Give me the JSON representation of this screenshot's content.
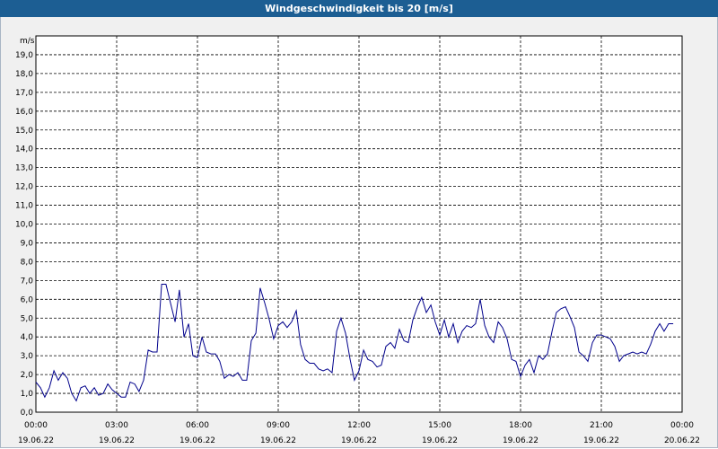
{
  "window": {
    "title": "Windgeschwindigkeit bis 20 [m/s]"
  },
  "colors": {
    "titlebar": "#1c5e93",
    "line": "#00008b",
    "grid": "#000000",
    "plot_bg": "#ffffff"
  },
  "chart_data": {
    "type": "line",
    "title": "Windgeschwindigkeit bis 20 [m/s]",
    "ylabel": "m/s",
    "xlabel": "",
    "ylim": [
      0,
      20
    ],
    "yticks": [
      "0,0",
      "1,0",
      "2,0",
      "3,0",
      "4,0",
      "5,0",
      "6,0",
      "7,0",
      "8,0",
      "9,0",
      "10,0",
      "11,0",
      "12,0",
      "13,0",
      "14,0",
      "15,0",
      "16,0",
      "17,0",
      "18,0",
      "19,0"
    ],
    "xticks": [
      {
        "time": "00:00",
        "date": "19.06.22"
      },
      {
        "time": "03:00",
        "date": "19.06.22"
      },
      {
        "time": "06:00",
        "date": "19.06.22"
      },
      {
        "time": "09:00",
        "date": "19.06.22"
      },
      {
        "time": "12:00",
        "date": "19.06.22"
      },
      {
        "time": "15:00",
        "date": "19.06.22"
      },
      {
        "time": "18:00",
        "date": "19.06.22"
      },
      {
        "time": "21:00",
        "date": "19.06.22"
      },
      {
        "time": "00:00",
        "date": "20.06.22"
      }
    ],
    "grid": true,
    "legend": "none",
    "series": [
      {
        "x_hours": [
          0,
          0.17,
          0.33,
          0.5,
          0.67,
          0.83,
          1,
          1.17,
          1.33,
          1.5,
          1.67,
          1.83,
          2,
          2.17,
          2.33,
          2.5,
          2.67,
          2.83,
          3,
          3.17,
          3.33,
          3.5,
          3.67,
          3.83,
          4,
          4.17,
          4.33,
          4.5,
          4.67,
          4.83,
          5,
          5.17,
          5.33,
          5.5,
          5.67,
          5.83,
          6,
          6.17,
          6.33,
          6.5,
          6.67,
          6.83,
          7,
          7.17,
          7.33,
          7.5,
          7.67,
          7.83,
          8,
          8.17,
          8.33,
          8.5,
          8.67,
          8.83,
          9,
          9.17,
          9.33,
          9.5,
          9.67,
          9.83,
          10,
          10.17,
          10.33,
          10.5,
          10.67,
          10.83,
          11,
          11.17,
          11.33,
          11.5,
          11.67,
          11.83,
          12,
          12.17,
          12.33,
          12.5,
          12.67,
          12.83,
          13,
          13.17,
          13.33,
          13.5,
          13.67,
          13.83,
          14,
          14.17,
          14.33,
          14.5,
          14.67,
          14.83,
          15,
          15.17,
          15.33,
          15.5,
          15.67,
          15.83,
          16,
          16.17,
          16.33,
          16.5,
          16.67,
          16.83,
          17,
          17.17,
          17.33,
          17.5,
          17.67,
          17.83,
          18,
          18.17,
          18.33,
          18.5,
          18.67,
          18.83,
          19,
          19.17,
          19.33,
          19.5,
          19.67,
          19.83,
          20,
          20.17,
          20.33,
          20.5,
          20.67,
          20.83,
          21,
          21.17,
          21.33,
          21.5,
          21.67,
          21.83,
          22,
          22.17,
          22.33,
          22.5,
          22.67,
          22.83,
          23,
          23.17,
          23.33,
          23.5,
          23.67,
          23.83
        ],
        "values": [
          1.6,
          1.3,
          0.8,
          1.3,
          2.2,
          1.7,
          2.1,
          1.8,
          1.0,
          0.6,
          1.3,
          1.4,
          1.0,
          1.3,
          0.9,
          1.0,
          1.5,
          1.2,
          1.0,
          0.8,
          0.8,
          1.6,
          1.5,
          1.1,
          1.7,
          3.3,
          3.2,
          3.2,
          6.8,
          6.8,
          5.8,
          4.8,
          6.5,
          4.0,
          4.7,
          3.0,
          2.9,
          4.0,
          3.2,
          3.1,
          3.1,
          2.7,
          1.8,
          2.0,
          1.9,
          2.1,
          1.7,
          1.7,
          3.8,
          4.2,
          6.6,
          5.8,
          4.9,
          3.9,
          4.6,
          4.8,
          4.5,
          4.8,
          5.4,
          3.6,
          2.8,
          2.6,
          2.6,
          2.3,
          2.2,
          2.3,
          2.1,
          4.3,
          5.0,
          4.2,
          2.8,
          1.7,
          2.2,
          3.3,
          2.8,
          2.7,
          2.4,
          2.5,
          3.5,
          3.7,
          3.4,
          4.4,
          3.8,
          3.7,
          4.9,
          5.6,
          6.1,
          5.3,
          5.7,
          4.8,
          4.1,
          4.9,
          4.0,
          4.7,
          3.7,
          4.3,
          4.6,
          4.5,
          4.7,
          6.0,
          4.6,
          4.0,
          3.7,
          4.8,
          4.5,
          3.9,
          2.8,
          2.7,
          1.9,
          2.5,
          2.8,
          2.1,
          3.0,
          2.8,
          3.1,
          4.3,
          5.3,
          5.5,
          5.6,
          5.1,
          4.5,
          3.2,
          3.0,
          2.7,
          3.7,
          4.1,
          4.1,
          4.0,
          3.9,
          3.5,
          2.7,
          3.0,
          3.1,
          3.2,
          3.1,
          3.2,
          3.1,
          3.6,
          4.3,
          4.7,
          4.3,
          4.7,
          4.7
        ]
      }
    ]
  }
}
